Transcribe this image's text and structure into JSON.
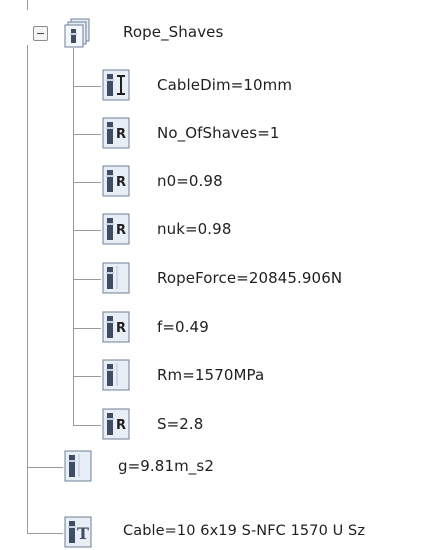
{
  "tree": {
    "root": {
      "label": "Rope_Shaves",
      "expanded": true,
      "icon": "parameter-set-icon"
    },
    "children": [
      {
        "label": "CableDim=10mm",
        "icon": "length-parameter-icon"
      },
      {
        "label": "No_OfShaves=1",
        "icon": "real-parameter-icon"
      },
      {
        "label": "n0=0.98",
        "icon": "real-parameter-icon"
      },
      {
        "label": "nuk=0.98",
        "icon": "real-parameter-icon"
      },
      {
        "label": "RopeForce=20845.906N",
        "icon": "parameter-icon"
      },
      {
        "label": "f=0.49",
        "icon": "real-parameter-icon"
      },
      {
        "label": "Rm=1570MPa",
        "icon": "parameter-icon"
      },
      {
        "label": "S=2.8",
        "icon": "real-parameter-icon"
      }
    ],
    "siblings": [
      {
        "label": "g=9.81m_s2",
        "icon": "parameter-icon"
      },
      {
        "label": "Cable=10 6x19 S-NFC 1570 U Sz",
        "icon": "text-parameter-icon"
      }
    ]
  },
  "colors": {
    "connector": "#9a9a9a",
    "icon_bg": "#e8eef6",
    "icon_border": "#6d7f96",
    "icon_dark": "#3f4c63"
  }
}
